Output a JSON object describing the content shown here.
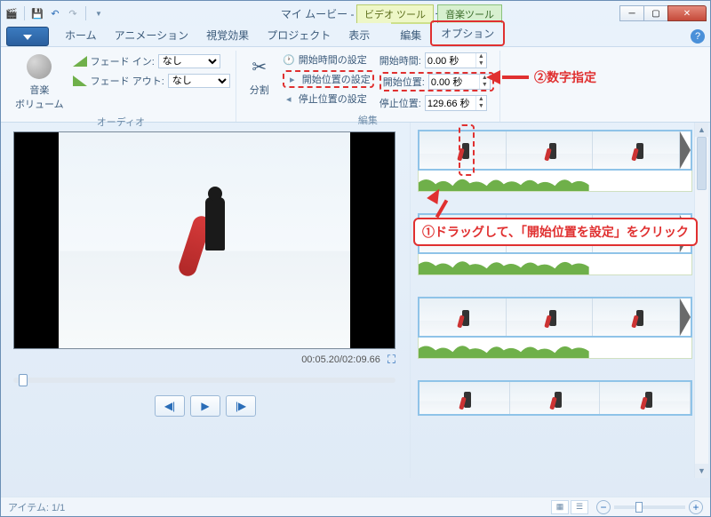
{
  "title": "マイ ムービー - ムービー メーカー",
  "tooltabs": {
    "video": "ビデオ ツール",
    "music": "音楽ツール"
  },
  "tabs": {
    "home": "ホーム",
    "animation": "アニメーション",
    "visual": "視覚効果",
    "project": "プロジェクト",
    "view": "表示",
    "edit": "編集",
    "options": "オプション"
  },
  "ribbon": {
    "audio_group": "オーディオ",
    "edit_group": "編集",
    "music_volume": "音楽\nボリューム",
    "split": "分割",
    "fade_in": "フェード イン:",
    "fade_out": "フェード アウト:",
    "fade_none": "なし",
    "set_start_time": "開始時間の設定",
    "set_start_pos": "開始位置の設定",
    "set_stop_pos": "停止位置の設定",
    "start_time_label": "開始時間:",
    "start_pos_label": "開始位置:",
    "stop_pos_label": "停止位置:",
    "start_time_val": "0.00 秒",
    "start_pos_val": "0.00 秒",
    "stop_pos_val": "129.66 秒"
  },
  "annotations": {
    "a1": "①ドラッグして、「開始位置を設定」をクリック",
    "a2": "②数字指定"
  },
  "preview": {
    "time": "00:05.20/02:09.66"
  },
  "status": {
    "items": "アイテム: 1/1"
  }
}
